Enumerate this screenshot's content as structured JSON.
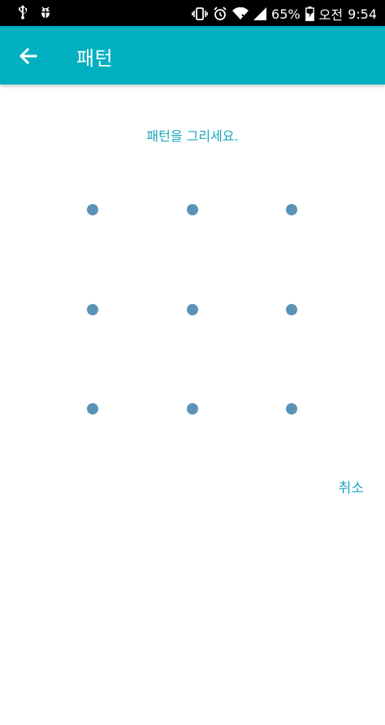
{
  "status_bar": {
    "battery_percent": "65%",
    "ampm": "오전",
    "time": "9:54",
    "left_icons": [
      "usb-icon",
      "debug-bug-icon"
    ],
    "right_icons": [
      "vibrate-icon",
      "alarm-icon",
      "wifi-icon",
      "signal-icon",
      "battery-charging-icon"
    ]
  },
  "app_bar": {
    "title": "패턴",
    "back_icon": "arrow-left-icon",
    "background_color": "#00b0c0"
  },
  "pattern": {
    "prompt": "패턴을 그리세요.",
    "rows": 3,
    "cols": 3,
    "dot_color": "#5b93b8"
  },
  "actions": {
    "cancel_label": "취소"
  },
  "colors": {
    "accent": "#18a8bc"
  }
}
